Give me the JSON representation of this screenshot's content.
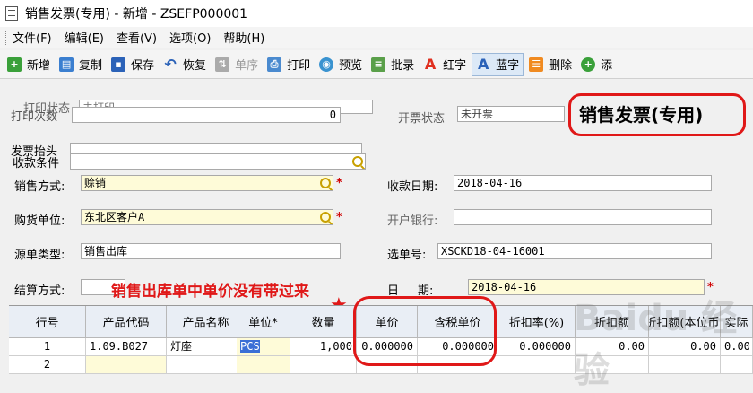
{
  "window": {
    "title": "销售发票(专用) - 新增 - ZSEFP000001"
  },
  "menu": [
    "文件(F)",
    "编辑(E)",
    "查看(V)",
    "选项(O)",
    "帮助(H)"
  ],
  "toolbar": {
    "new": "新增",
    "copy": "复制",
    "save": "保存",
    "restore": "恢复",
    "order": "单序",
    "print": "打印",
    "preview": "预览",
    "batch": "批录",
    "red": "红字",
    "blue": "蓝字",
    "delete": "删除",
    "more": "添"
  },
  "form": {
    "print_status_label": "打印状态",
    "print_status_value": "未打印",
    "print_count_label": "打印次数",
    "print_count_value": "0",
    "invoice_status_label": "开票状态",
    "invoice_status_value": "未开票",
    "doc_title": "销售发票(专用)",
    "invoice_header_label": "发票抬头",
    "invoice_header_value": "",
    "payment_terms_label": "收款条件",
    "payment_terms_value": "",
    "sale_method_label": "销售方式:",
    "sale_method_value": "赊销",
    "collect_date_label": "收款日期:",
    "collect_date_value": "2018-04-16",
    "buyer_label": "购货单位:",
    "buyer_value": "东北区客户A",
    "bank_label": "开户银行:",
    "bank_value": "",
    "source_type_label": "源单类型:",
    "source_type_value": "销售出库",
    "source_no_label": "选单号:",
    "source_no_value": "XSCKD18-04-16001",
    "settle_label": "结算方式:",
    "settle_value": "",
    "date_label_1": "日",
    "date_label_2": "期:",
    "date_value": "2018-04-16"
  },
  "annotation": "销售出库单中单价没有带过来",
  "watermark": "Baidu 经验",
  "grid": {
    "headers": [
      "行号",
      "产品代码",
      "产品名称",
      "单位*",
      "数量",
      "单价",
      "含税单价",
      "折扣率(%)",
      "折扣额",
      "折扣额(本位币)",
      "实际"
    ],
    "rows": [
      [
        "1",
        "1.09.B027",
        "灯座",
        "PCS",
        "1,000",
        "0.000000",
        "0.000000",
        "0.000000",
        "0.00",
        "0.00",
        "0.00"
      ],
      [
        "2",
        "",
        "",
        "",
        "",
        "",
        "",
        "",
        "",
        "",
        ""
      ]
    ]
  },
  "colors": {
    "annotation_red": "#e01818",
    "required_red": "#d00000",
    "field_yellow": "#fefbd8",
    "selection_blue": "#3b6fd6"
  }
}
